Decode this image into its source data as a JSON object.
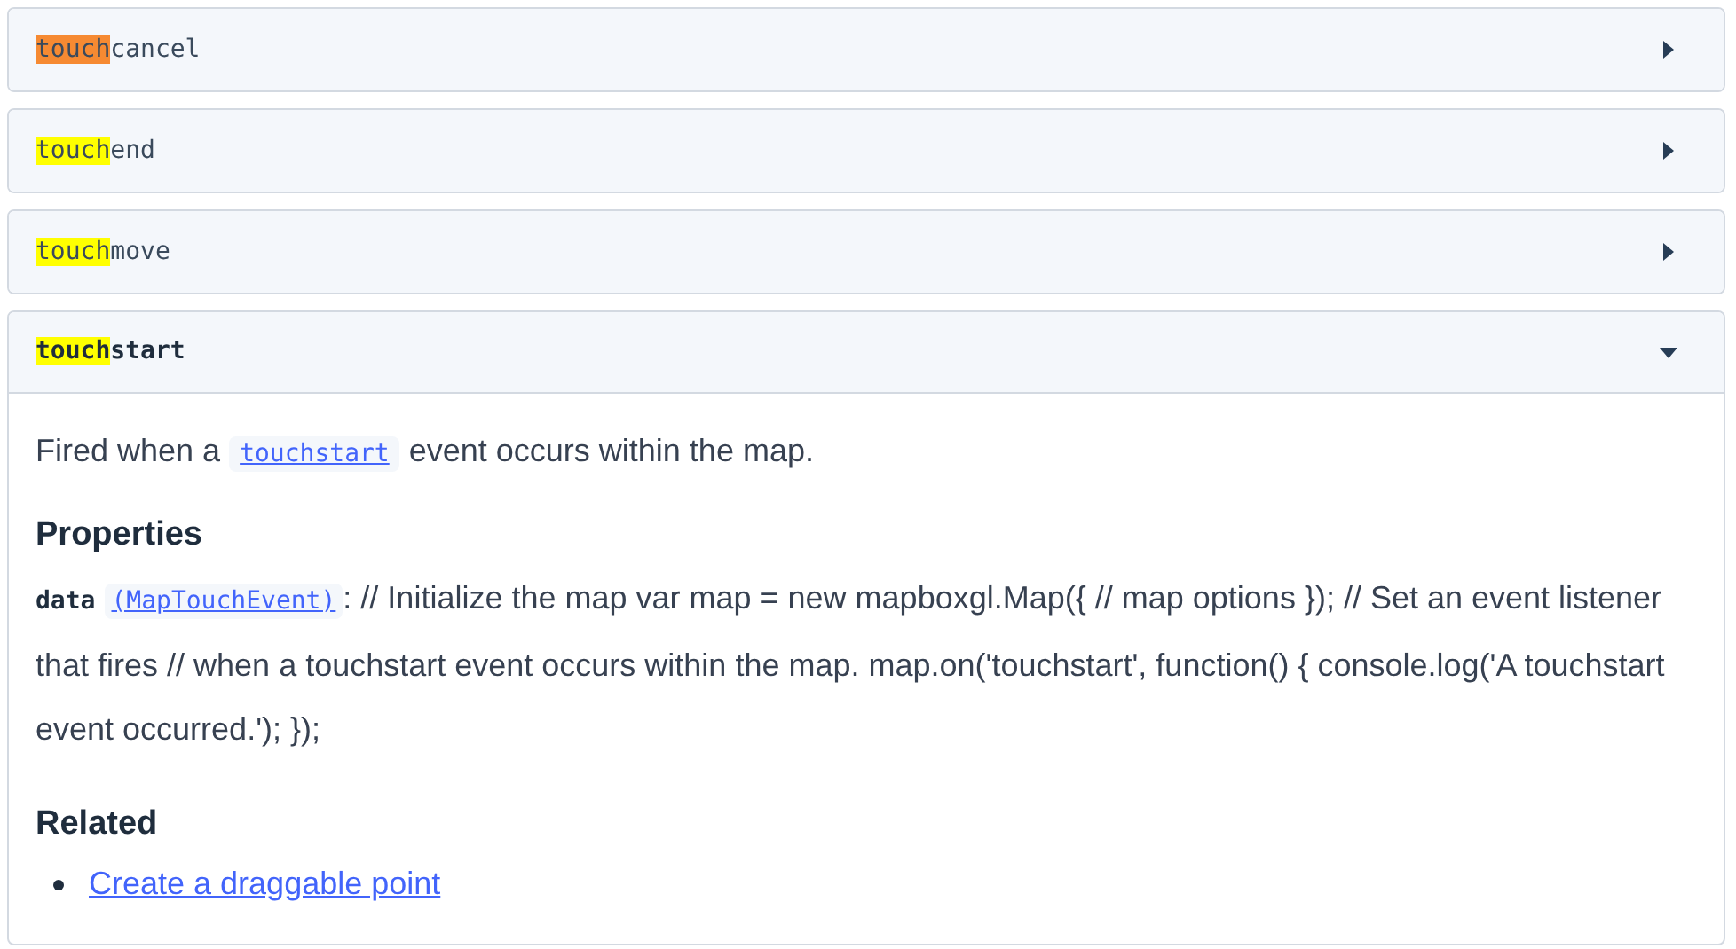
{
  "events": [
    {
      "match": "touch",
      "rest": "cancel",
      "color": "#f68a32",
      "expanded": false
    },
    {
      "match": "touch",
      "rest": "end",
      "color": "#ffff00",
      "expanded": false
    },
    {
      "match": "touch",
      "rest": "move",
      "color": "#ffff00",
      "expanded": false
    },
    {
      "match": "touch",
      "rest": "start",
      "color": "#ffff00",
      "expanded": true,
      "description": {
        "before": "Fired when a",
        "code": "touchstart",
        "after": "event occurs within the map."
      },
      "properties": {
        "heading": "Properties",
        "items": [
          {
            "name": "data",
            "type": "(MapTouchEvent)",
            "text": ": // Initialize the map var map = new mapboxgl.Map({ // map options }); // Set an event listener that fires // when a touchstart event occurs within the map. map.on('touchstart', function() { console.log('A touchstart event occurred.'); });"
          }
        ]
      },
      "related": {
        "heading": "Related",
        "links": [
          "Create a draggable point"
        ]
      }
    }
  ]
}
